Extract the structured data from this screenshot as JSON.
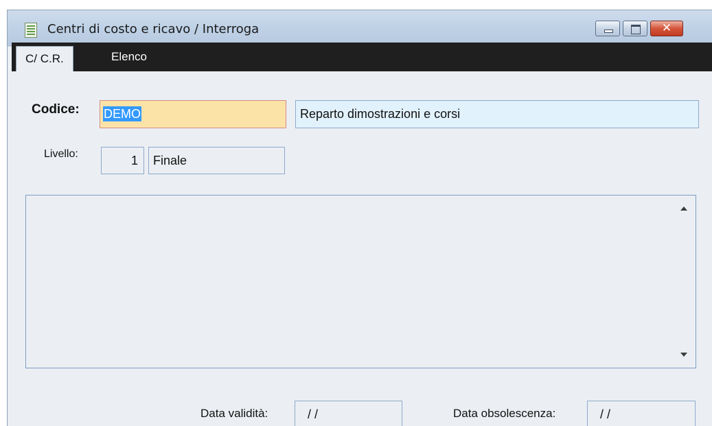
{
  "window": {
    "title": "Centri di costo e ricavo / Interroga",
    "close_glyph": "✕"
  },
  "tabs": [
    {
      "label": "C/ C.R.",
      "active": true
    },
    {
      "label": "Elenco",
      "active": false
    }
  ],
  "form": {
    "codice_label": "Codice:",
    "codice_value": "DEMO",
    "descrizione_value": "Reparto dimostrazioni e corsi",
    "livello_label": "Livello:",
    "livello_value": "1",
    "livello_desc": "Finale",
    "data_validita_label": "Data validità:",
    "data_validita_value": " /  /",
    "data_obsolescenza_label": "Data obsolescenza:",
    "data_obsolescenza_value": " /  /"
  },
  "colors": {
    "codice_bg": "#fbe3a8",
    "descrizione_bg": "#e2f2fd",
    "selection": "#3399ff",
    "tabbar": "#1f1f1f"
  },
  "icons": {
    "app": "form-icon",
    "minimize": "minimize-icon",
    "maximize": "maximize-icon",
    "close": "close-icon"
  }
}
